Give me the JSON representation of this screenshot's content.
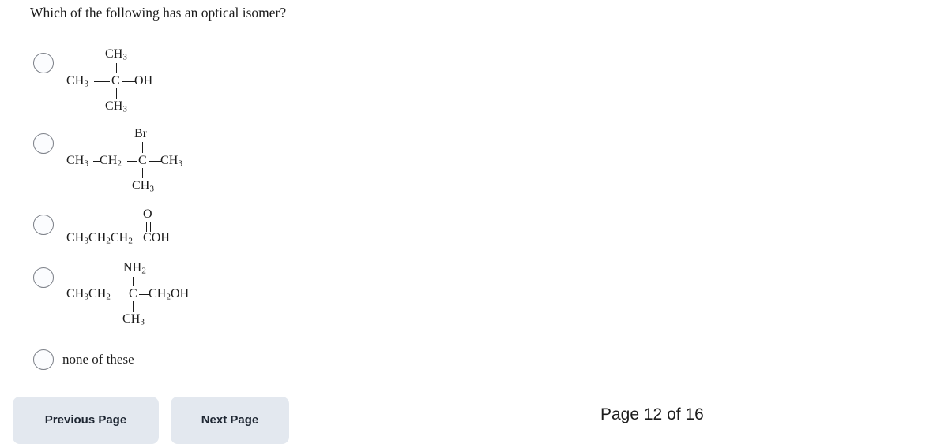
{
  "question": {
    "text": "Which of the following has an optical isomer?"
  },
  "options": [
    {
      "id": "option-1",
      "type": "structure",
      "name": "tert-butanol",
      "parts": {
        "top": "CH3",
        "left": "CH3",
        "center": "C",
        "right": "OH",
        "bottom": "CH3"
      }
    },
    {
      "id": "option-2",
      "type": "structure",
      "name": "2-bromo-2-methylbutane",
      "parts": {
        "top": "Br",
        "left": "CH3-CH2",
        "center": "C",
        "right": "CH3",
        "bottom": "CH3"
      }
    },
    {
      "id": "option-3",
      "type": "structure",
      "name": "butanoic-acid",
      "parts": {
        "top": "O",
        "chain": "CH3CH2CH2",
        "acid": "COH"
      }
    },
    {
      "id": "option-4",
      "type": "structure",
      "name": "2-amino-2-methylbutan-1-ol",
      "parts": {
        "top": "NH2",
        "left": "CH3CH2",
        "center": "C",
        "right": "CH2OH",
        "bottom": "CH3"
      }
    },
    {
      "id": "option-5",
      "type": "text",
      "name": "none-of-these",
      "label": "none of these"
    }
  ],
  "footer": {
    "previous_label": "Previous Page",
    "next_label": "Next Page",
    "page_indicator": "Page 12 of 16"
  },
  "colors": {
    "background": "#ffffff",
    "text": "#1c1c1c",
    "button_background": "#e3e8ef",
    "button_text": "#1f2733",
    "radio_border": "#7b7f87",
    "radio_fill": "#fbfcfe"
  }
}
